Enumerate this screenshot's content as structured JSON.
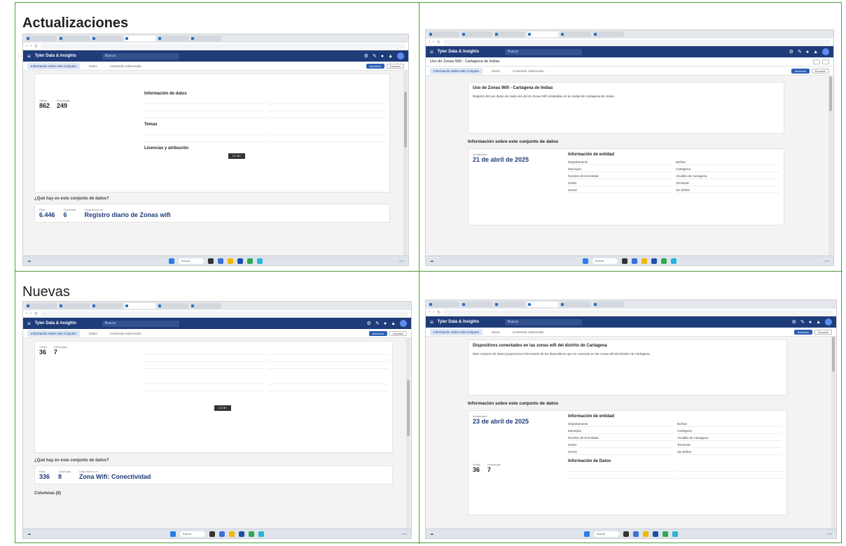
{
  "panels": [
    {
      "heading": "Actualizaciones"
    },
    {
      "heading": ""
    },
    {
      "heading": "Nuevas"
    },
    {
      "heading": ""
    }
  ],
  "app": {
    "brand": "Tyler Data & Insights",
    "search_placeholder": "Buscar",
    "subtab_about": "Información sobre este Conjunto",
    "subtab_data": "Datos",
    "subtab_community": "Contenido relacionado",
    "btn_actions": "Acciones",
    "btn_export": "Exportar"
  },
  "shot1": {
    "downloads_label": "Vistas",
    "downloads_label2": "Descargas",
    "stat1": "862",
    "stat2": "249",
    "section_datos": "Información de datos",
    "section_temas": "Temas",
    "section_licencia": "Licencias y atribución",
    "question": "¿Qué hay en este conjunto de datos?",
    "rows_label": "Filas",
    "cols_label": "Columnas",
    "each_row": "Cada fila es un",
    "rows": "6.446",
    "cols": "6",
    "row_name": "Registro diario de Zonas wifi"
  },
  "shot2": {
    "breadcrumb": "Uso de Zonas Wifi - Cartagena de Indias",
    "title": "Uso de Zonas Wifi - Cartagena de Indias",
    "desc": "Registro del uso diario de cada una de las Zonas Wifi instaladas en la ciudad de Cartagena de Indias.",
    "info_title": "Información sobre este conjunto de datos",
    "updated_label": "Actualizado",
    "updated": "21 de abril de 2025",
    "entity_title": "Información de entidad",
    "entity_rows": [
      [
        "Departamento",
        "Bolívar"
      ],
      [
        "Municipio",
        "Cartagena"
      ],
      [
        "Nombre de la Entidad",
        "Alcaldía de Cartagena"
      ],
      [
        "Orden",
        "Territorial"
      ],
      [
        "Sector",
        "Sin definir"
      ]
    ]
  },
  "shot3": {
    "stat_label1": "Vistas",
    "stat_label2": "Descargas",
    "stat1": "36",
    "stat2": "7",
    "question": "¿Qué hay en este conjunto de datos?",
    "rows_label": "Filas",
    "cols_label": "Columnas",
    "each_row": "Cada fila es un",
    "rows": "336",
    "cols": "8",
    "row_name": "Zona Wifi: Conectividad",
    "columns": "Columnas (8)"
  },
  "shot4": {
    "title": "Dispositivos conectados en las zonas wifi del distrito de Cartagena",
    "desc": "Este conjunto de datos proporciona información de los dispositivos que se conectan en las zonas wifi del Distrito de Cartagena.",
    "info_title": "Información sobre este conjunto de datos",
    "updated_label": "Actualizado",
    "updated": "23 de abril de 2025",
    "entity_title": "Información de entidad",
    "entity_rows": [
      [
        "Departamento",
        "Bolívar"
      ],
      [
        "Municipio",
        "Cartagena"
      ],
      [
        "Nombre de la Entidad",
        "Alcaldía de Cartagena"
      ],
      [
        "Orden",
        "Territorial"
      ],
      [
        "Sector",
        "Sin definir"
      ]
    ],
    "data_title": "Información de Datos",
    "stat_label1": "Vistas",
    "stat_label2": "Descargas",
    "stat1": "36",
    "stat2": "7"
  },
  "taskbar": {
    "search": "Buscar"
  }
}
